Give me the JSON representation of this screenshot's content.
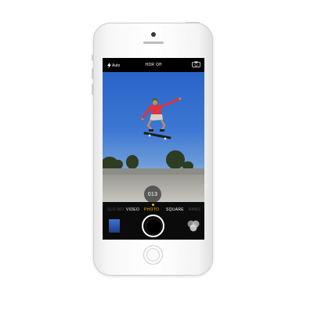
{
  "camera": {
    "flash_label": "Auto",
    "hdr_label": "HDR Off",
    "counter": "013",
    "modes": [
      {
        "label": "SLO-MO"
      },
      {
        "label": "VIDEO"
      },
      {
        "label": "PHOTO"
      },
      {
        "label": "SQUARE"
      },
      {
        "label": "PANO"
      }
    ],
    "selected_mode": "PHOTO"
  },
  "icons": {
    "flash": "lightning-bolt-icon",
    "switch_camera": "camera-switch-icon",
    "filters": "filters-icon"
  },
  "colors": {
    "accent": "#f5b800",
    "screen_bg": "#000000",
    "body": "#ffffff"
  }
}
